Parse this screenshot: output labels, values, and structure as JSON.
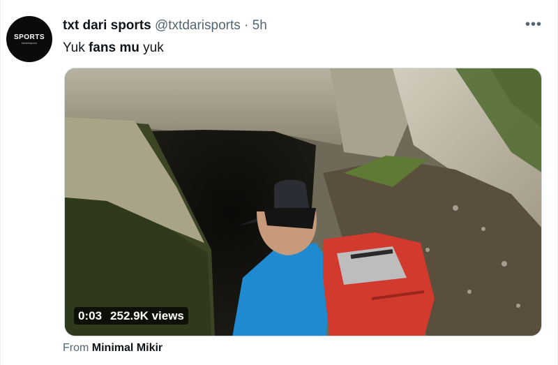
{
  "tweet": {
    "avatar_text": "SPORTS",
    "avatar_subtext": "txtdarisports",
    "display_name": "txt dari sports",
    "handle": "@txtdarisports",
    "separator": "·",
    "timestamp": "5h",
    "more_icon": "more-horizontal-icon",
    "text_before": "Yuk ",
    "text_bold": "fans mu",
    "text_after": " yuk"
  },
  "video": {
    "duration": "0:03",
    "views": "252.9K views"
  },
  "source": {
    "prefix": "From ",
    "name": "Minimal Mikir"
  },
  "colors": {
    "text": "#0f1419",
    "secondary": "#536471",
    "border": "#cfd9de"
  }
}
